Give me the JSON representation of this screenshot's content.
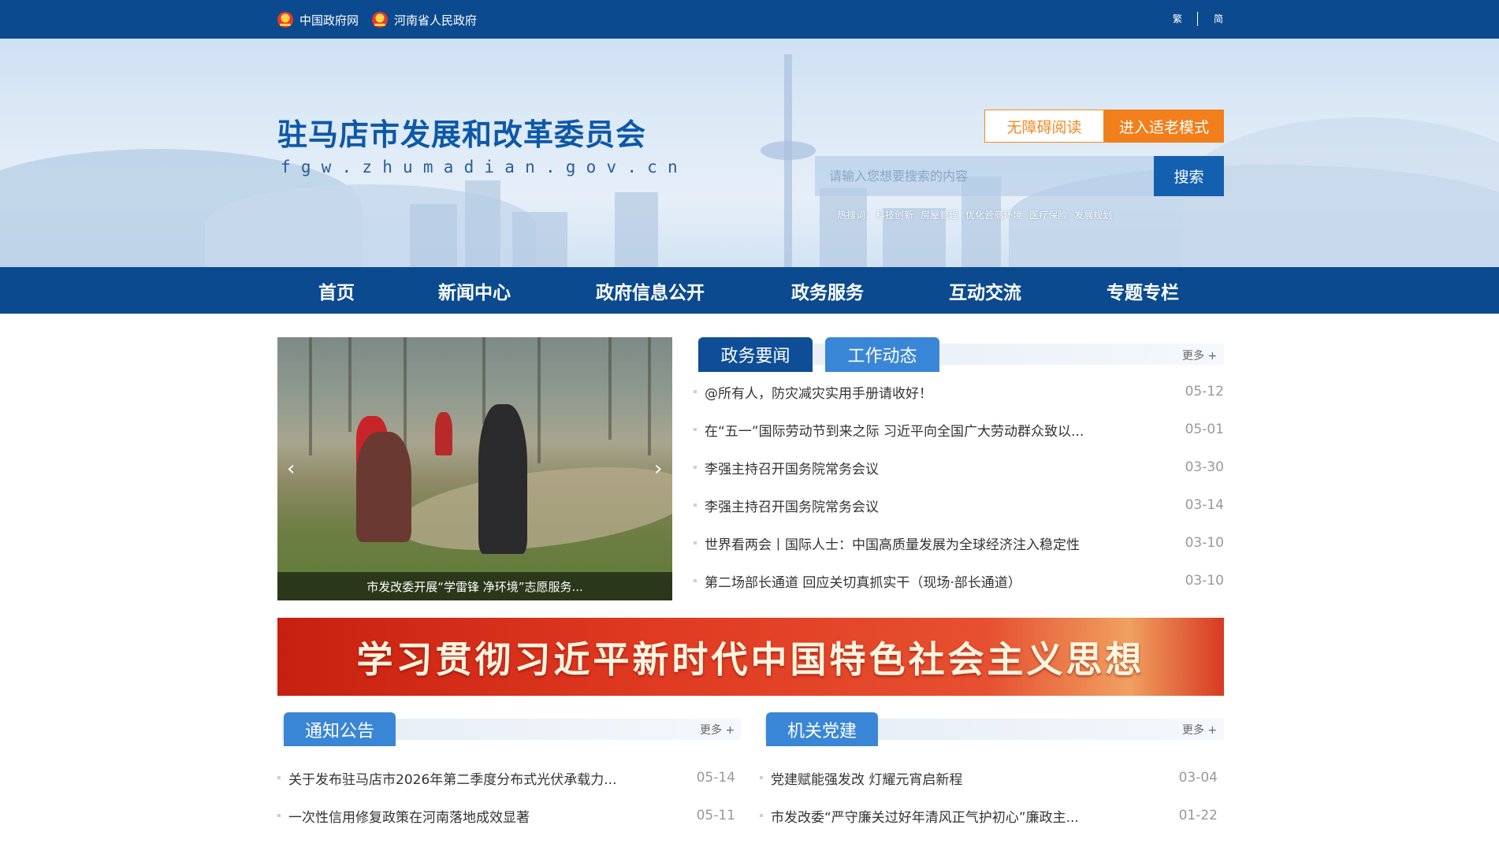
{
  "topbar": {
    "links": [
      "中国政府网",
      "河南省人民政府"
    ],
    "lang_traditional": "繁",
    "lang_simplified": "简"
  },
  "header": {
    "title": "驻马店市发展和改革委员会",
    "domain": "fgw.zhumadian.gov.cn",
    "accessibility_label": "无障碍阅读",
    "elder_mode_label": "进入适老模式",
    "search_placeholder": "请输入您想要搜索的内容",
    "search_button": "搜索",
    "hot_label": "热搜词:",
    "hot_words": [
      "科技创新",
      "房屋管理",
      "优化营商环境",
      "医疗保险",
      "发展规划"
    ]
  },
  "nav": {
    "items": [
      "首页",
      "新闻中心",
      "政府信息公开",
      "政务服务",
      "互动交流",
      "专题专栏"
    ]
  },
  "slider": {
    "caption": "市发改委开展“学雷锋 净环境”志愿服务...",
    "prev_icon": "chevron-left-icon",
    "next_icon": "chevron-right-icon"
  },
  "news": {
    "tabs": [
      "政务要闻",
      "工作动态"
    ],
    "more": "更多 +",
    "items": [
      {
        "title": "@所有人，防灾减灾实用手册请收好！",
        "date": "05-12"
      },
      {
        "title": "在“五一”国际劳动节到来之际 习近平向全国广大劳动群众致以...",
        "date": "05-01"
      },
      {
        "title": "李强主持召开国务院常务会议",
        "date": "03-30"
      },
      {
        "title": "李强主持召开国务院常务会议",
        "date": "03-14"
      },
      {
        "title": "世界看两会丨国际人士：中国高质量发展为全球经济注入稳定性",
        "date": "03-10"
      },
      {
        "title": "第二场部长通道 回应关切真抓实干（现场·部长通道）",
        "date": "03-10"
      }
    ]
  },
  "promo_banner": {
    "text": "学习贯彻习近平新时代中国特色社会主义思想"
  },
  "notices": {
    "tab": "通知公告",
    "more": "更多 +",
    "items": [
      {
        "title": "关于发布驻马店市2026年第二季度分布式光伏承载力...",
        "date": "05-14"
      },
      {
        "title": "一次性信用修复政策在河南落地成效显著",
        "date": "05-11"
      }
    ]
  },
  "party": {
    "tab": "机关党建",
    "more": "更多 +",
    "items": [
      {
        "title": "党建赋能强发改 灯耀元宵启新程",
        "date": "03-04"
      },
      {
        "title": "市发改委“严守廉关过好年清风正气护初心”廉政主...",
        "date": "01-22"
      }
    ]
  },
  "colors": {
    "primary": "#0b4a8f",
    "tab_light": "#3a86d6",
    "accent_orange": "#f07f1c",
    "banner_red": "#d8301a"
  }
}
